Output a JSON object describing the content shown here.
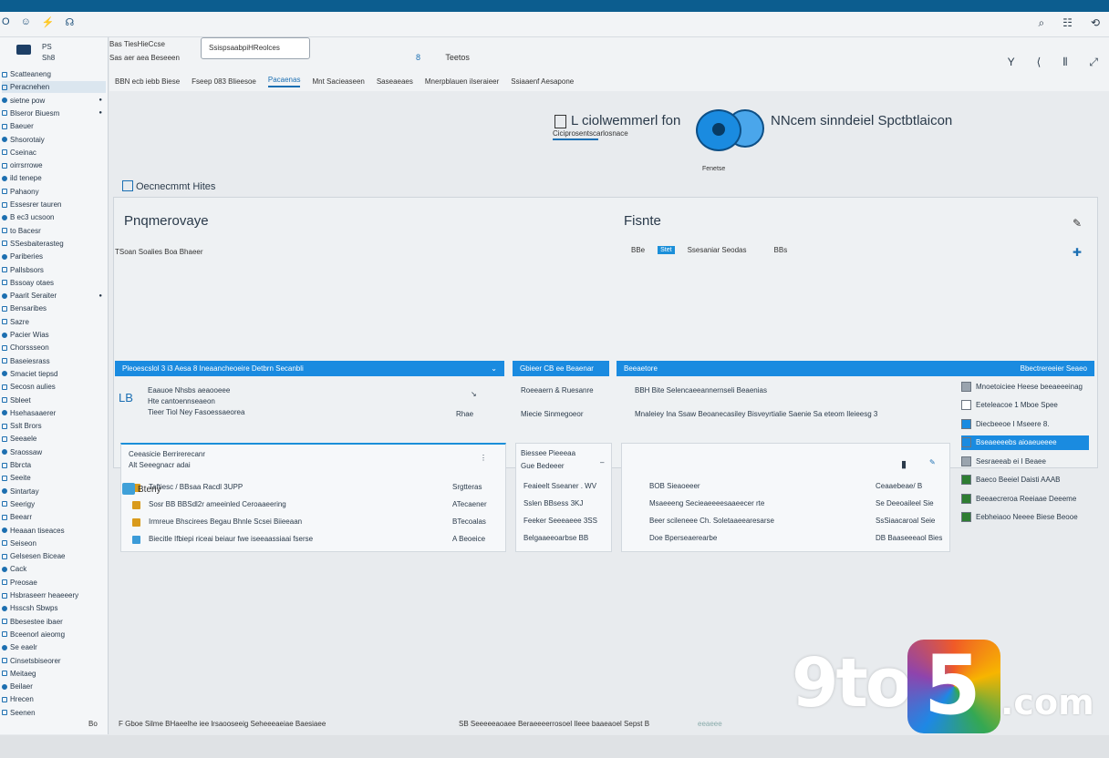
{
  "window": {
    "title_icons": [
      "O",
      "☺",
      "⚡",
      "☊"
    ],
    "controls": [
      "⌕",
      "☷",
      "⟲"
    ]
  },
  "sidebar": {
    "header_line1": "PS",
    "header_line2": "Sh8",
    "items": [
      {
        "label": "Scatteaneng",
        "selected": false
      },
      {
        "label": "Peracnehen",
        "selected": true
      },
      {
        "label": "sietne pow",
        "selected": false
      },
      {
        "label": "Blseror Biuesm",
        "selected": false
      },
      {
        "label": "Baeuer",
        "selected": false
      },
      {
        "label": "Shsorotaiy",
        "selected": false
      },
      {
        "label": "Cseinac",
        "selected": false
      },
      {
        "label": "oirrsrrowe",
        "selected": false
      },
      {
        "label": "ild tenepe",
        "selected": false
      },
      {
        "label": "Pahaony",
        "selected": false
      },
      {
        "label": "Essesrer tauren",
        "selected": false
      },
      {
        "label": "B ec3 ucsoon",
        "selected": false
      },
      {
        "label": "to Bacesr",
        "selected": false
      },
      {
        "label": "SSesbaiterasteg",
        "selected": false
      },
      {
        "label": "Pariberies",
        "selected": false
      },
      {
        "label": "Pallsbsors",
        "selected": false
      },
      {
        "label": "Bssoay otaes",
        "selected": false
      },
      {
        "label": "Paarit Seraiter",
        "selected": false
      },
      {
        "label": "Bensaribes",
        "selected": false
      },
      {
        "label": "Sazre",
        "selected": false
      },
      {
        "label": "Pacier Wias",
        "selected": false
      },
      {
        "label": "Chorssseon",
        "selected": false
      },
      {
        "label": "Baseiesrass",
        "selected": false
      },
      {
        "label": "Smaciet tiepsd",
        "selected": false
      },
      {
        "label": "Secosn aulies",
        "selected": false
      },
      {
        "label": "Sbleet",
        "selected": false
      },
      {
        "label": "Hsehasaaerer",
        "selected": false
      },
      {
        "label": "Sslt Brors",
        "selected": false
      },
      {
        "label": "Seeaele",
        "selected": false
      },
      {
        "label": "Sraossaw",
        "selected": false
      },
      {
        "label": "Bbrcta",
        "selected": false
      },
      {
        "label": "Seeite",
        "selected": false
      },
      {
        "label": "Sintartay",
        "selected": false
      },
      {
        "label": "Seerigy",
        "selected": false
      },
      {
        "label": "Beearr",
        "selected": false
      },
      {
        "label": "Heaaan tiseaces",
        "selected": false
      },
      {
        "label": "Seiseon",
        "selected": false
      },
      {
        "label": "Gelsesen Biceae",
        "selected": false
      },
      {
        "label": "Cack",
        "selected": false
      },
      {
        "label": "Preosae",
        "selected": false
      },
      {
        "label": "Hsbraseerr heaeeery",
        "selected": false
      },
      {
        "label": "Hsscsh Sbwps",
        "selected": false
      },
      {
        "label": "Bbesestee ibaer",
        "selected": false
      },
      {
        "label": "Bceenorl aieomg",
        "selected": false
      },
      {
        "label": "Se eaelr",
        "selected": false
      },
      {
        "label": "Cinsetsbiseorer",
        "selected": false
      },
      {
        "label": "Meitaeg",
        "selected": false
      },
      {
        "label": "Beilaer",
        "selected": false
      },
      {
        "label": "Hrecen",
        "selected": false
      },
      {
        "label": "Seenen",
        "selected": false
      }
    ]
  },
  "appbar": {
    "left_line1": "Bas  TiesHieCcse",
    "left_line2": "Sas aer aea Beseeen",
    "search_value": "SsispsaabpiHReolces",
    "mid_letter": "8",
    "mid_text": "Teetos",
    "tabs": [
      {
        "label": "BBN ecb iebb Biese",
        "active": false
      },
      {
        "label": "Fseep 083 Blieesoe",
        "active": false
      },
      {
        "label": "Pacaenas",
        "active": true
      },
      {
        "label": "Mnt Sacieaseen",
        "active": false
      },
      {
        "label": "Saseaeaes",
        "active": false
      },
      {
        "label": "Mnerpblauen ilseraieer",
        "active": false
      },
      {
        "label": "Ssiaaenf Aesapone",
        "active": false
      }
    ],
    "icons": [
      "Y",
      "⟨",
      "⫴",
      "⤢"
    ]
  },
  "hero": {
    "left_title": "L  ciolwemmerl fon",
    "left_sub": "Ciciprosentscarlosnace",
    "caption": "Fenetse",
    "right_title": "NNcem sinndeiel Spctbtlaicon"
  },
  "section": {
    "title": "Oecnecmmt Hites"
  },
  "panel": {
    "heading_left": "Pnqmerovaye",
    "heading_right": "Fisnte",
    "row1": "TSoan Soalies     Boa   Bhaeer",
    "row2_a": "BBe",
    "row2_pill": "Stet",
    "row2_b": "Ssesaniar Seodas",
    "row2_c": "BBs",
    "bar_left": "Pleoescslol   3 i3 Aesa 8 Ineaancheoeire Detbrn Secanbli",
    "bar_mid": "Gbieer CB ee Beaenar",
    "bar_right_a": "Beeaetore",
    "bar_right_b": "Bbectrereeier Seaeo",
    "block1_l1": "Eaauoe Nhsbs aeaooeee",
    "block1_l2": "Hte cantoennseaeon",
    "block1_l3": "Tieer Tiol    Ney Fasoessaeorea",
    "block1_r": "Rhae",
    "block2_l1": "Roeeaern & Ruesanre",
    "block2_l2": "Miecie Sinmegoeor",
    "block3_l1": "BBH Bite Selencaeeannernseli Beaenias",
    "block3_l2": "Mnaleiey Ina Ssaw Beoanecasiley Bisveyrtialie Saenie Sa eteom Ileieesg 3",
    "card1_title": "Ceeasicie Berrirerecanr",
    "card1_sub": "Alt Seeegnacr adai",
    "card1_rows": [
      {
        "icon": "#d99b1c",
        "left": "Taftiesc / BBsaa Racdl 3UPP",
        "right": "Srgtteras"
      },
      {
        "icon": "#d99b1c",
        "left": "Sosr BB BBSdl2r ameeinled Ceroaaeering",
        "right": "ATecaener"
      },
      {
        "icon": "#d99b1c",
        "left": "Irmreue Bhscirees Begau  Bhnle Scsei Biieeaan",
        "right": "BTecoalas"
      },
      {
        "icon": "#3b9bd8",
        "left": "Biecitle Ifbiepi riceai beiaur fwe iseeaassiaai fserse",
        "right": "A Beoeice"
      }
    ],
    "card2_title": "Biessee Pieeeaa",
    "card2_sub": "Gue Bedeeer",
    "card2_rows": [
      {
        "left": "Feaieelt Sseaner . WV",
        "right": ""
      },
      {
        "left": "Sslen BBsess   3KJ",
        "right": ""
      },
      {
        "left": "Feeker Seeeaeee   3SS",
        "right": ""
      },
      {
        "left": "Belgaaeeoarbse   BB",
        "right": ""
      }
    ],
    "card3_rows": [
      {
        "left": "BOB Sieaoeeer",
        "right": "Ceaaebeae/ B"
      },
      {
        "left": "Msaeeeng Secieaeeeesaaeecer rte",
        "right": "Se Deeoaileel Sie"
      },
      {
        "left": "Beer scileneee Ch. Soletaaeearesarse",
        "right": "SsSiaacaroal Seie"
      },
      {
        "left": "Doe Bperseaerearbe",
        "right": "DB Baaseeeaol Bies"
      }
    ],
    "right_list": [
      {
        "label": "Mnoetoiciee Heese beeaeeeinag",
        "color": "#9aa4ae",
        "selected": false
      },
      {
        "label": "Eeteleacoe 1 Mboe Spee",
        "color": "#ffffff",
        "selected": false
      },
      {
        "label": "Diecbeeoe I Mseere 8.",
        "color": "#1a8be0",
        "selected": false
      },
      {
        "label": "Bseaeeeebs aioaeueeee",
        "color": "#1a8be0",
        "selected": true
      },
      {
        "label": "Sesraeeab ei I Beaee",
        "color": "#9aa4ae",
        "selected": false
      },
      {
        "label": "Baeco Beeiel Daisti AAAB",
        "color": "#2e7d32",
        "selected": false
      },
      {
        "label": "Beeaecreroa Reeiaae Deeeme",
        "color": "#2e7d32",
        "selected": false
      },
      {
        "label": "Eebheiaoo Neeee Biese Beooe",
        "color": "#2e7d32",
        "selected": false
      }
    ]
  },
  "history": {
    "label": "Bteny"
  },
  "status": {
    "s1": "Bo",
    "s2": "F Gboe Silme BHaeelhe iee lrsaooseeig Seheeeaeiae Baesiaee",
    "s3": "SB Seeeeeaoaee Beraeeeerrosoel Ileee baaeaoel Sepst B",
    "s4": "eeaeee"
  },
  "watermark": {
    "part1": "9to",
    "part2": "5",
    "part3": ".com"
  },
  "colors": {
    "accent": "#1a8be0",
    "titlebar": "#0c5d8f"
  }
}
